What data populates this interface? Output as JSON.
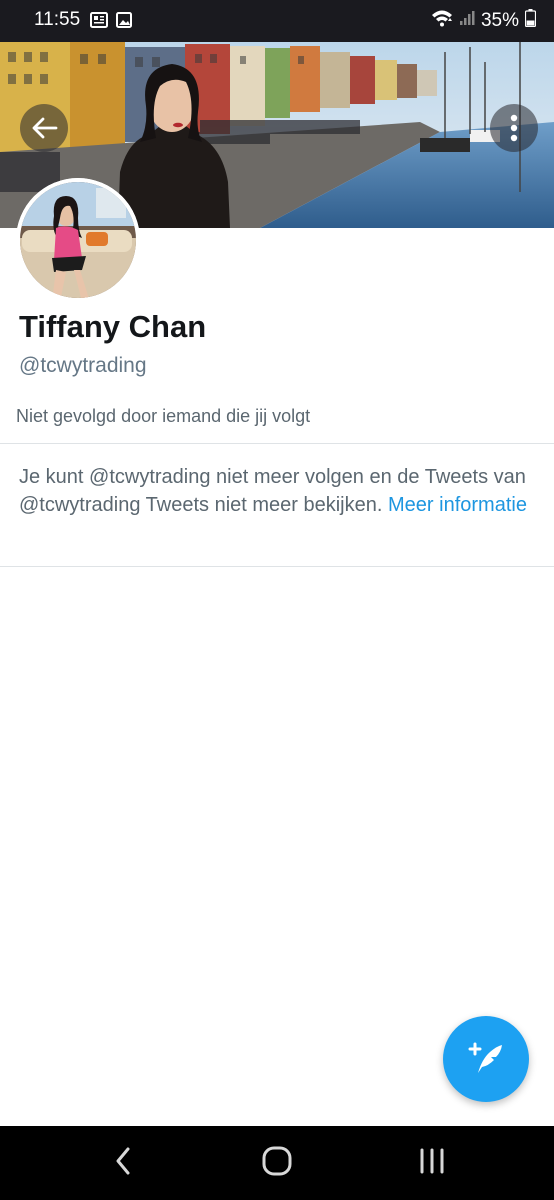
{
  "status_bar": {
    "time": "11:55",
    "battery": "35%",
    "icons": [
      "newspaper-icon",
      "image-icon",
      "wifi-icon",
      "signal-icon",
      "battery-icon"
    ]
  },
  "header": {
    "back_icon": "arrow-left-icon",
    "more_icon": "more-vertical-icon"
  },
  "profile": {
    "name": "Tiffany Chan",
    "handle": "@tcwytrading",
    "followers_note": "Niet gevolgd door iemand die jij volgt"
  },
  "notice": {
    "text": "Je kunt @tcwytrading niet meer volgen en de Tweets van @tcwytrading Tweets niet meer bekijken.",
    "link": "Meer informatie"
  },
  "fab": {
    "icon": "compose-tweet-icon"
  },
  "nav_bar": {
    "icons": [
      "back-nav-icon",
      "home-nav-icon",
      "recents-nav-icon"
    ]
  },
  "colors": {
    "accent": "#1da1f2",
    "link": "#1d96e0",
    "text_primary": "#14171a",
    "text_secondary": "#657786"
  }
}
